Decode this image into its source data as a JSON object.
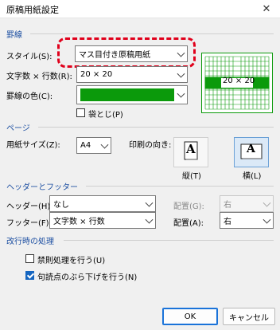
{
  "window": {
    "title": "原稿用紙設定",
    "close_glyph": "✕"
  },
  "ruled_lines": {
    "section": "罫線",
    "style_label": "スタイル(S):",
    "style_value": "マス目付き原稿用紙",
    "chars_label": "文字数 × 行数(R):",
    "chars_value": "20 × 20",
    "color_label": "罫線の色(C):",
    "color_value": "#0b9a0b",
    "binding_label": "袋とじ(P)",
    "binding_checked": false,
    "preview_text": "20 × 20"
  },
  "page": {
    "section": "ページ",
    "size_label": "用紙サイズ(Z):",
    "size_value": "A4",
    "orientation_label": "印刷の向き:",
    "portrait_label": "縦(T)",
    "landscape_label": "横(L)",
    "orientation_selected": "landscape",
    "page_glyph": "A"
  },
  "header_footer": {
    "section": "ヘッダーとフッター",
    "header_label": "ヘッダー(H):",
    "header_value": "なし",
    "header_align_label": "配置(G):",
    "header_align_value": "右",
    "footer_label": "フッター(F):",
    "footer_value": "文字数 × 行数",
    "footer_align_label": "配置(A):",
    "footer_align_value": "右"
  },
  "line_break": {
    "section": "改行時の処理",
    "kinsoku_label": "禁則処理を行う(U)",
    "kinsoku_checked": false,
    "burasage_label": "句読点のぶら下げを行う(N)",
    "burasage_checked": true
  },
  "buttons": {
    "ok": "OK",
    "cancel": "キャンセル"
  }
}
